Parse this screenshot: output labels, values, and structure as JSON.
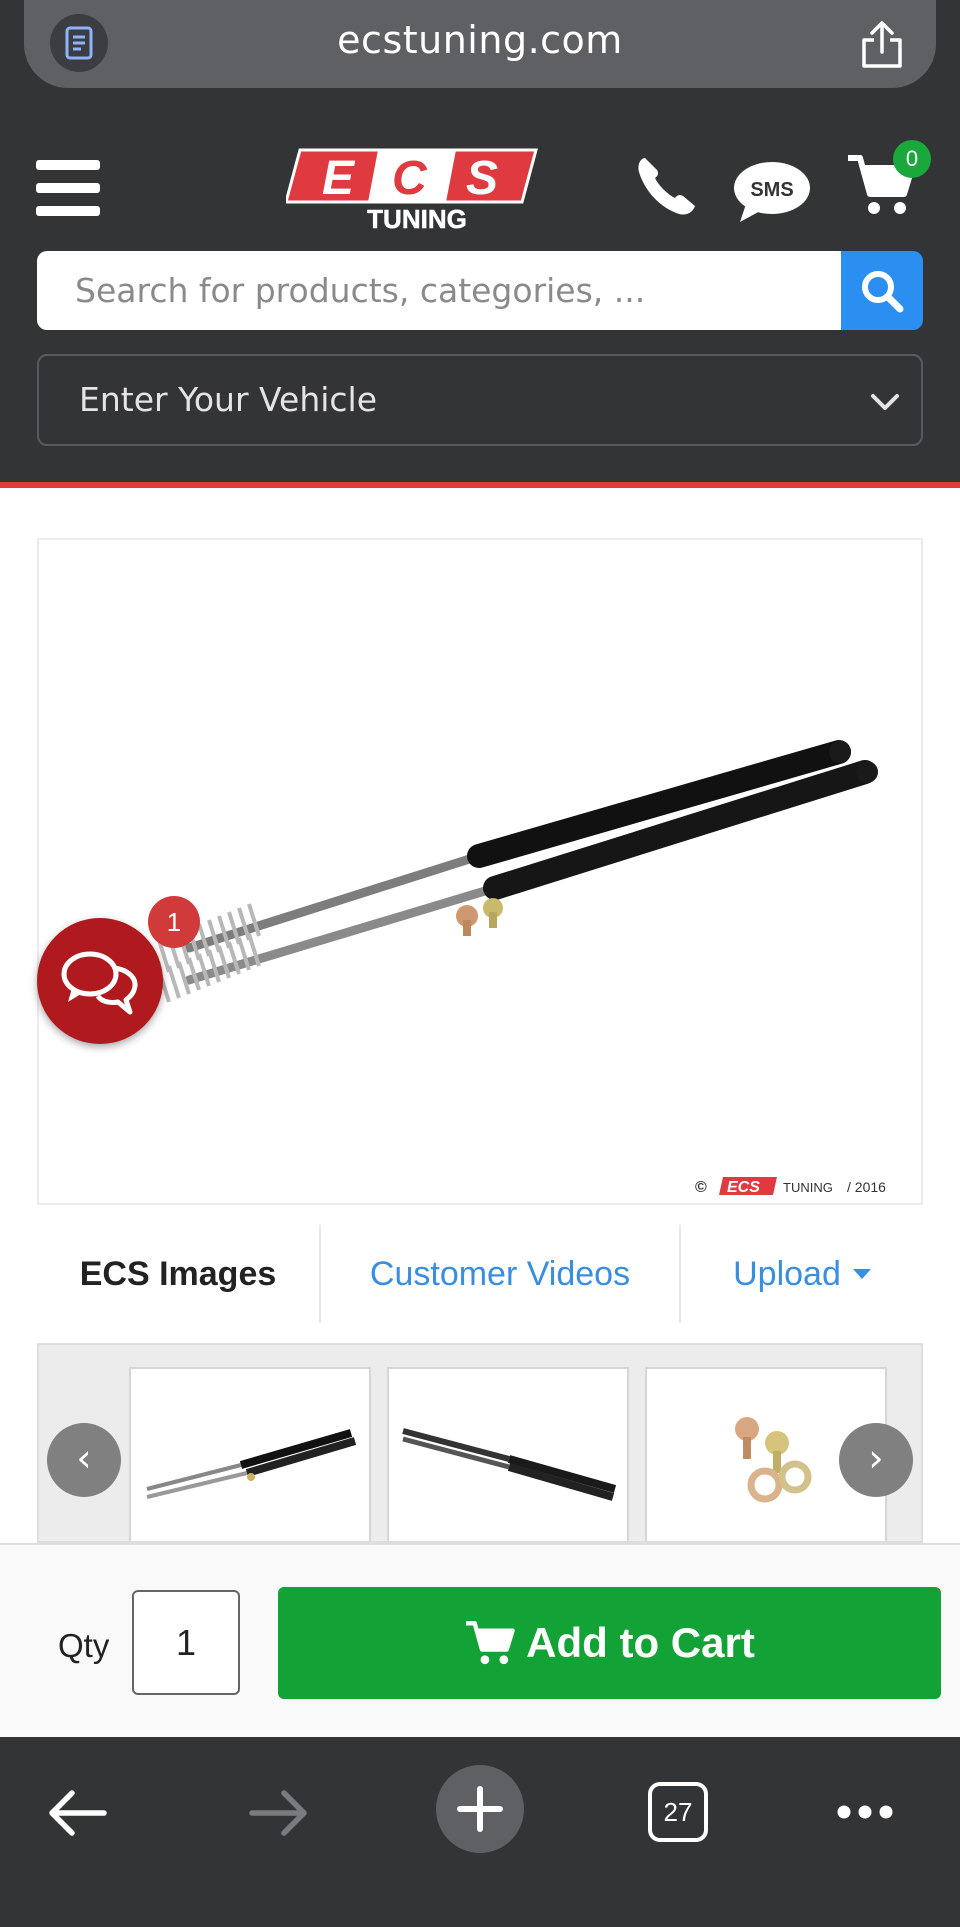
{
  "browser": {
    "url": "ecstuning.com",
    "open_tabs": "27"
  },
  "header": {
    "logo_letters": "ECS",
    "logo_sub": "TUNING",
    "sms_label": "SMS",
    "cart_count": "0",
    "search_placeholder": "Search for products, categories, ...",
    "vehicle_label": "Enter Your Vehicle"
  },
  "product": {
    "watermark": "© ECS TUNING / 2016"
  },
  "chat": {
    "badge": "1"
  },
  "tabs": {
    "ecs_images": "ECS Images",
    "customer_videos": "Customer Videos",
    "upload": "Upload"
  },
  "carousel": {
    "prev": "‹",
    "next": "›"
  },
  "cart_bar": {
    "qty_label": "Qty",
    "qty_value": "1",
    "add_to_cart": "Add to Cart"
  },
  "colors": {
    "header_bg": "#333436",
    "accent_red": "#e03a41",
    "search_blue": "#2a8ff0",
    "cart_green": "#12a236",
    "link_blue": "#3a8ee0",
    "chat_red": "#b0191d"
  },
  "icons": [
    "document-icon",
    "share-icon",
    "hamburger-icon",
    "phone-icon",
    "sms-icon",
    "cart-icon",
    "search-icon",
    "chevron-down-icon",
    "chat-icon",
    "back-icon",
    "forward-icon",
    "plus-icon",
    "more-icon"
  ]
}
